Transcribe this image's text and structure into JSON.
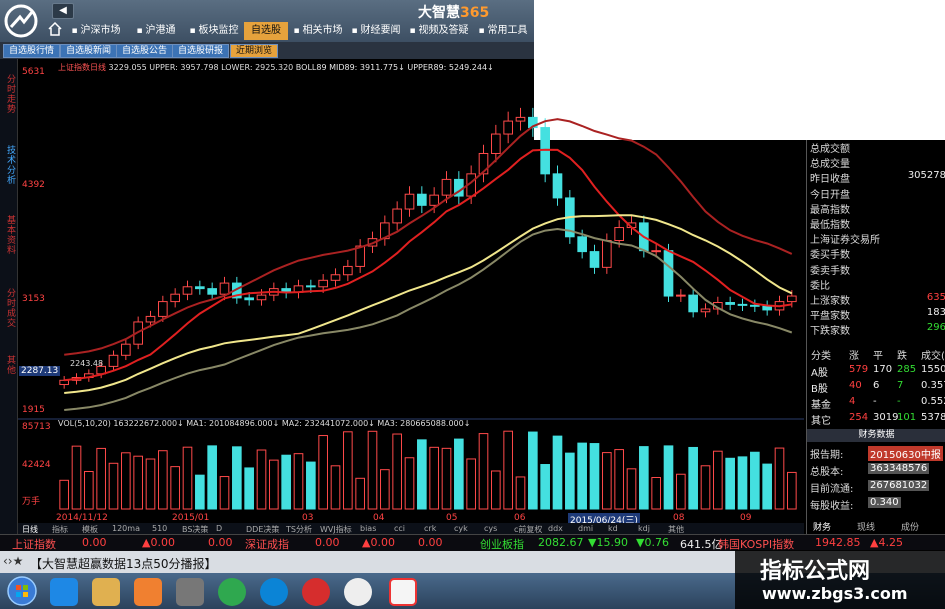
{
  "app": {
    "brand": "大智慧",
    "brand_suffix": "365",
    "nav_back": "◀",
    "nav_fwd": "▶",
    "main_menu": [
      {
        "label": "沪深市场",
        "active": false
      },
      {
        "label": "沪港通",
        "active": false
      },
      {
        "label": "板块监控",
        "active": false
      },
      {
        "label": "自选股",
        "active": true
      },
      {
        "label": "相关市场",
        "active": false
      },
      {
        "label": "财经要闻",
        "active": false
      },
      {
        "label": "视频及答疑",
        "active": false
      },
      {
        "label": "常用工具",
        "active": false
      }
    ],
    "sub_tabs": [
      {
        "label": "自选股行情",
        "active": false
      },
      {
        "label": "自选股新闻",
        "active": false
      },
      {
        "label": "自选股公告",
        "active": false
      },
      {
        "label": "自选股研报",
        "active": false
      },
      {
        "label": "近期浏览",
        "active": true
      }
    ],
    "left_tabs": [
      "分时走势",
      "技术分析",
      "基本资料",
      "分时成交",
      "其他"
    ]
  },
  "chart": {
    "title_prefix": "上证指数日线",
    "title_indicators": "BOLL89  MID89: 3911.775↓  UPPER89: 5249.244↓",
    "title_hidden": "3229.055  UPPER: 3957.798  LOWER: 2925.320",
    "y_labels": [
      "5631",
      "4392",
      "3153",
      "2287.13",
      "1915"
    ],
    "price_marker": "2243.48",
    "vol_title": "VOL(5,10,20)  163222672.000↓  MA1: 201084896.000↓  MA2: 232441072.000↓  MA3: 280665088.000↓",
    "vol_labels": [
      "85713",
      "42424",
      "万手"
    ],
    "x_labels": [
      "2014/11/12",
      "2015/01",
      "03",
      "04",
      "05",
      "06",
      "2015/06/24(三)",
      "08",
      "09"
    ],
    "ind_tabs": [
      "日线",
      "指标",
      "模板",
      "120ma",
      "510",
      "BS决策",
      "D",
      "DDE决策",
      "TS分析",
      "WVJ指标",
      "bias",
      "cci",
      "crk",
      "cyk",
      "cys",
      "c前复权",
      "ddx",
      "dmi",
      "kd",
      "kdj",
      "其他"
    ]
  },
  "chart_data": {
    "type": "candlestick",
    "title": "上证指数日线",
    "ylim": [
      1915,
      5631
    ],
    "y_ticks": [
      1915,
      3153,
      4392,
      5631
    ],
    "start_date": "2014/11/12",
    "close": [
      2290,
      2320,
      2360,
      2440,
      2560,
      2680,
      2920,
      2980,
      3140,
      3220,
      3300,
      3280,
      3220,
      3340,
      3180,
      3160,
      3210,
      3280,
      3240,
      3310,
      3300,
      3370,
      3430,
      3520,
      3740,
      3820,
      3990,
      4140,
      4300,
      4180,
      4290,
      4460,
      4280,
      4520,
      4740,
      4950,
      5090,
      5130,
      5020,
      4520,
      4260,
      3840,
      3680,
      3510,
      3800,
      3940,
      3990,
      3690,
      3690,
      3200,
      3210,
      3030,
      3060,
      3130,
      3110,
      3100,
      3090,
      3050,
      3140,
      3200
    ]
  },
  "right_panel": {
    "rows": [
      {
        "label": "总成交额",
        "value": "",
        "cls": "white"
      },
      {
        "label": "总成交量",
        "value": "",
        "cls": "white"
      },
      {
        "label": "昨日收盘",
        "value": "305278",
        "cls": "white"
      },
      {
        "label": "今日开盘",
        "value": "",
        "cls": "white"
      },
      {
        "label": "最高指数",
        "value": "",
        "cls": "white"
      },
      {
        "label": "最低指数",
        "value": "",
        "cls": "white"
      },
      {
        "label": "上海证券交易所",
        "value": "",
        "cls": "white"
      },
      {
        "label": "委买手数",
        "value": "",
        "cls": "white"
      },
      {
        "label": "委卖手数",
        "value": "",
        "cls": "white"
      },
      {
        "label": "委比",
        "value": "",
        "cls": "white"
      },
      {
        "label": "上涨家数",
        "value": "635",
        "cls": "red"
      },
      {
        "label": "平盘家数",
        "value": "183",
        "cls": "white"
      },
      {
        "label": "下跌家数",
        "value": "296",
        "cls": "green"
      }
    ],
    "table_head": [
      "分类",
      "涨",
      "平",
      "跌",
      "成交(亿"
    ],
    "table": [
      {
        "name": "A股",
        "up": "579",
        "flat": "170",
        "down": "285",
        "amt": "1550"
      },
      {
        "name": "B股",
        "up": "40",
        "flat": "6",
        "down": "7",
        "amt": "0.357"
      },
      {
        "name": "基金",
        "up": "4",
        "flat": "-",
        "down": "-",
        "amt": "0.552"
      },
      {
        "name": "其它",
        "up": "254",
        "flat": "3019",
        "down": "101",
        "amt": "5378"
      }
    ],
    "fin_head": "财务数据",
    "fin_rows": [
      {
        "label": "报告期:",
        "value": "20150630中报"
      },
      {
        "label": "总股本:",
        "value": "363348576"
      },
      {
        "label": "目前流通:",
        "value": "267681032"
      },
      {
        "label": "每股收益:",
        "value": "0.340"
      }
    ],
    "bottom_tabs": [
      "财务",
      "现线",
      "成份"
    ]
  },
  "ticker": {
    "items": [
      {
        "name": "上证指数",
        "v1": "0.00",
        "v2": "▲0.00",
        "v3": "0.00"
      },
      {
        "name": "深证成指",
        "v1": "0.00",
        "v2": "▲0.00",
        "v3": "0.00"
      },
      {
        "name": "创业板指",
        "v1": "2082.67",
        "v2": "▼15.90",
        "v3": "▼0.76"
      }
    ],
    "extra": "641.5亿",
    "korea": "韩国KOSPI指数",
    "korea_val": "1942.85",
    "korea_chg": "▲4.25"
  },
  "news": {
    "text": "【大智慧超赢数据13点50分播报】"
  },
  "watermark": {
    "line1": "指标公式网",
    "line2": "www.zbgs3.com"
  }
}
